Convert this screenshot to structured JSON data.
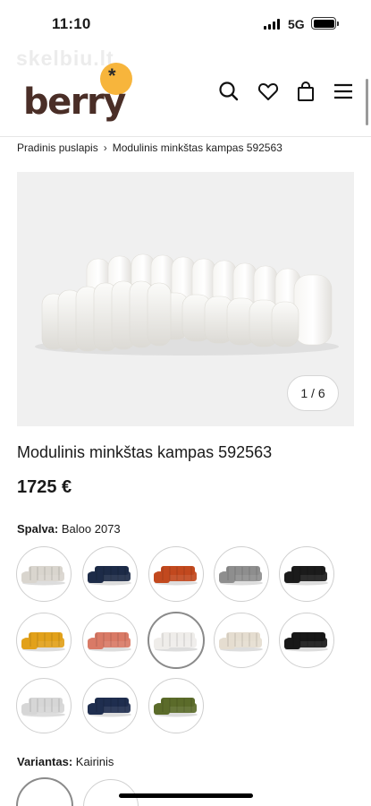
{
  "status": {
    "time": "11:10",
    "network": "5G"
  },
  "watermark": "skelbiu.lt",
  "brand": {
    "logo_text": "berry",
    "logo_mark": "*",
    "accent": "#f7b53c",
    "text_color": "#4a2e27"
  },
  "header_icons": [
    "search-icon",
    "heart-icon",
    "bag-icon",
    "menu-icon"
  ],
  "breadcrumb": {
    "home": "Pradinis puslapis",
    "current": "Modulinis minkštas kampas 592563"
  },
  "gallery": {
    "pager": "1 / 6"
  },
  "product": {
    "title": "Modulinis minkštas kampas 592563",
    "price": "1725 €"
  },
  "color": {
    "label": "Spalva:",
    "value": "Baloo 2073"
  },
  "swatches": [
    {
      "color": "#d9d5ce",
      "selected": false
    },
    {
      "color": "#1d2b48",
      "selected": false
    },
    {
      "color": "#c2491e",
      "selected": false
    },
    {
      "color": "#8e8e8e",
      "selected": false
    },
    {
      "color": "#1b1b1b",
      "selected": false
    },
    {
      "color": "#e2a11a",
      "selected": false
    },
    {
      "color": "#d97a66",
      "selected": false
    },
    {
      "color": "#efedea",
      "selected": true
    },
    {
      "color": "#e5ddd0",
      "selected": false
    },
    {
      "color": "#181818",
      "selected": false
    },
    {
      "color": "#d6d6d6",
      "selected": false
    },
    {
      "color": "#1f2e4f",
      "selected": false
    },
    {
      "color": "#5b6b2a",
      "selected": false
    }
  ],
  "variant": {
    "label": "Variantas:",
    "value": "Kairinis"
  }
}
